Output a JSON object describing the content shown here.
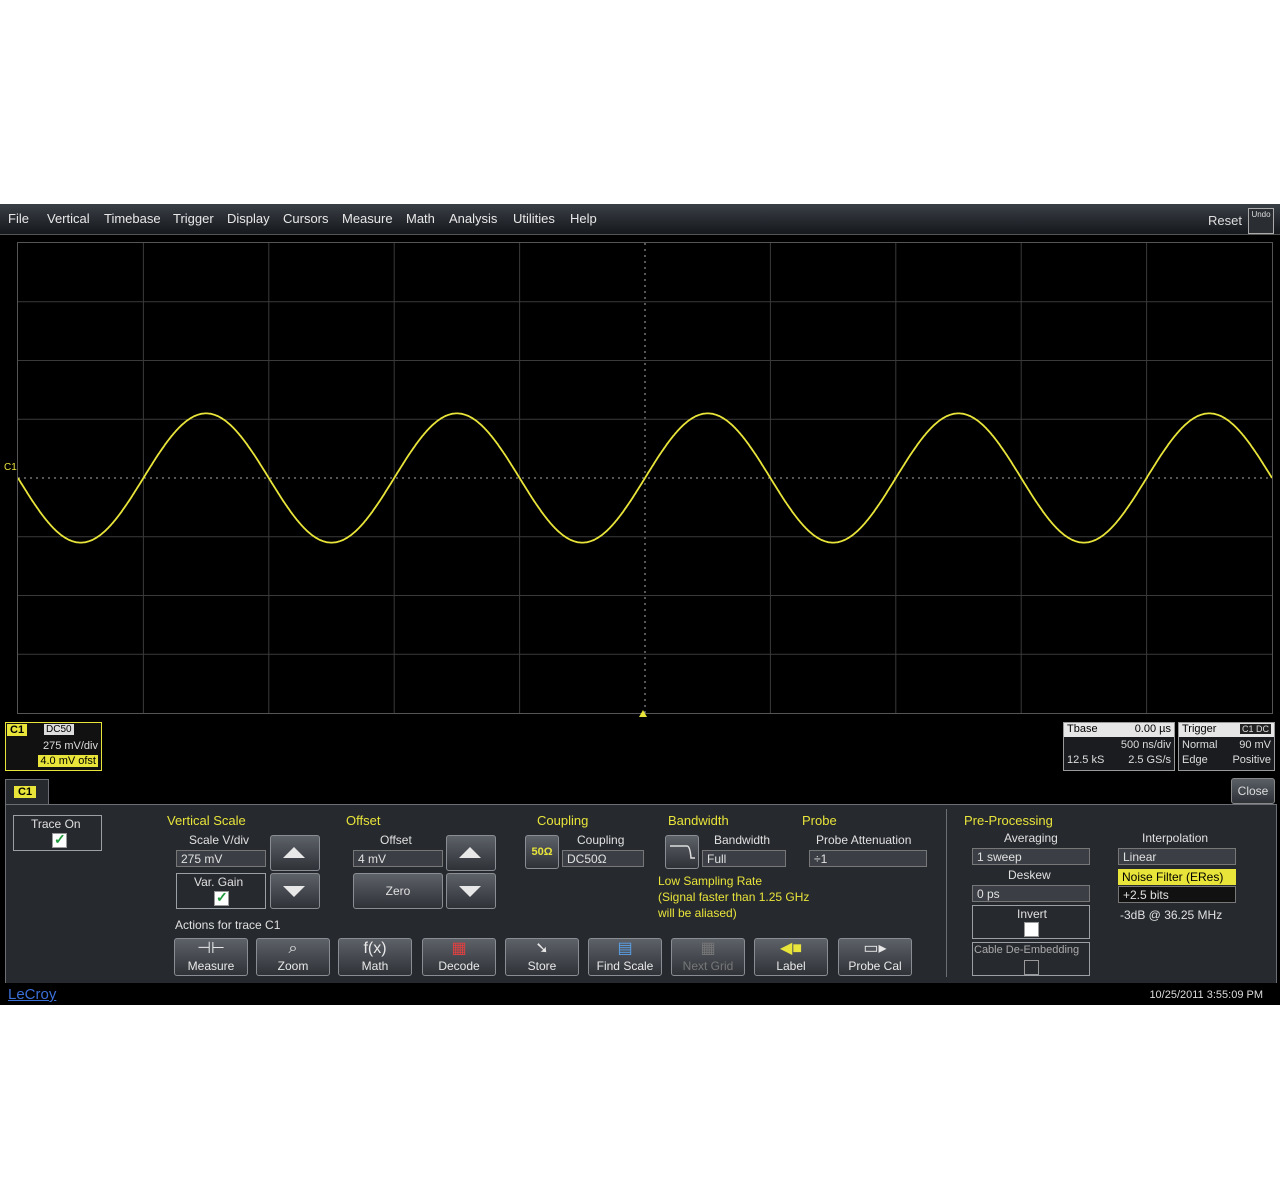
{
  "menu": {
    "items": [
      "File",
      "Vertical",
      "Timebase",
      "Trigger",
      "Display",
      "Cursors",
      "Measure",
      "Math",
      "Analysis",
      "Utilities",
      "Help"
    ],
    "reset": "Reset",
    "undo": "Undo"
  },
  "waveform": {
    "trace": "C1",
    "color": "#e8e43a",
    "cycles": 5,
    "amplitude_div": 1.1
  },
  "c1_descriptor": {
    "tag": "C1",
    "coupling": "DC50",
    "scale": "275 mV/div",
    "offset": "4.0 mV ofst"
  },
  "timebase_box": {
    "title": "Tbase",
    "delay": "0.00 µs",
    "tdiv": "500 ns/div",
    "samples": "12.5 kS",
    "rate": "2.5 GS/s"
  },
  "trigger_box": {
    "title": "Trigger",
    "mode": "Normal",
    "level": "90 mV",
    "type": "Edge",
    "slope": "Positive"
  },
  "tab": {
    "label": "C1"
  },
  "close": "Close",
  "trace_on": {
    "label": "Trace On"
  },
  "vertical_scale": {
    "title": "Vertical Scale",
    "label": "Scale V/div",
    "value": "275 mV",
    "var_gain": "Var. Gain"
  },
  "offset": {
    "title": "Offset",
    "label": "Offset",
    "value": "4 mV",
    "zero": "Zero"
  },
  "coupling": {
    "title": "Coupling",
    "label": "Coupling",
    "value": "DC50Ω",
    "ohm_icon": "50Ω"
  },
  "bandwidth": {
    "title": "Bandwidth",
    "label": "Bandwidth",
    "value": "Full"
  },
  "probe": {
    "title": "Probe",
    "label": "Probe Attenuation",
    "value": "÷1"
  },
  "low_sampling": {
    "line1": "Low Sampling Rate",
    "line2": "(Signal faster than 1.25 GHz",
    "line3": "will be aliased)"
  },
  "actions": {
    "title": "Actions for trace C1",
    "buttons": [
      {
        "label": "Measure",
        "icon": "measure-icon"
      },
      {
        "label": "Zoom",
        "icon": "zoom-icon"
      },
      {
        "label": "Math",
        "icon": "math-icon"
      },
      {
        "label": "Decode",
        "icon": "decode-icon"
      },
      {
        "label": "Store",
        "icon": "store-icon"
      },
      {
        "label": "Find Scale",
        "icon": "find-scale-icon"
      },
      {
        "label": "Next Grid",
        "icon": "next-grid-icon"
      },
      {
        "label": "Label",
        "icon": "label-icon"
      },
      {
        "label": "Probe Cal",
        "icon": "probe-cal-icon"
      }
    ]
  },
  "preprocessing": {
    "title": "Pre-Processing",
    "averaging_label": "Averaging",
    "averaging_value": "1 sweep",
    "deskew_label": "Deskew",
    "deskew_value": "0 ps",
    "invert_label": "Invert",
    "cable_label": "Cable De-Embedding"
  },
  "interpolation": {
    "label": "Interpolation",
    "value": "Linear",
    "noise_filter": "Noise Filter (ERes)",
    "bits": "+2.5 bits",
    "bw_note": "-3dB @ 36.25 MHz"
  },
  "status": {
    "logo": "LeCroy",
    "datetime": "10/25/2011 3:55:09 PM"
  }
}
